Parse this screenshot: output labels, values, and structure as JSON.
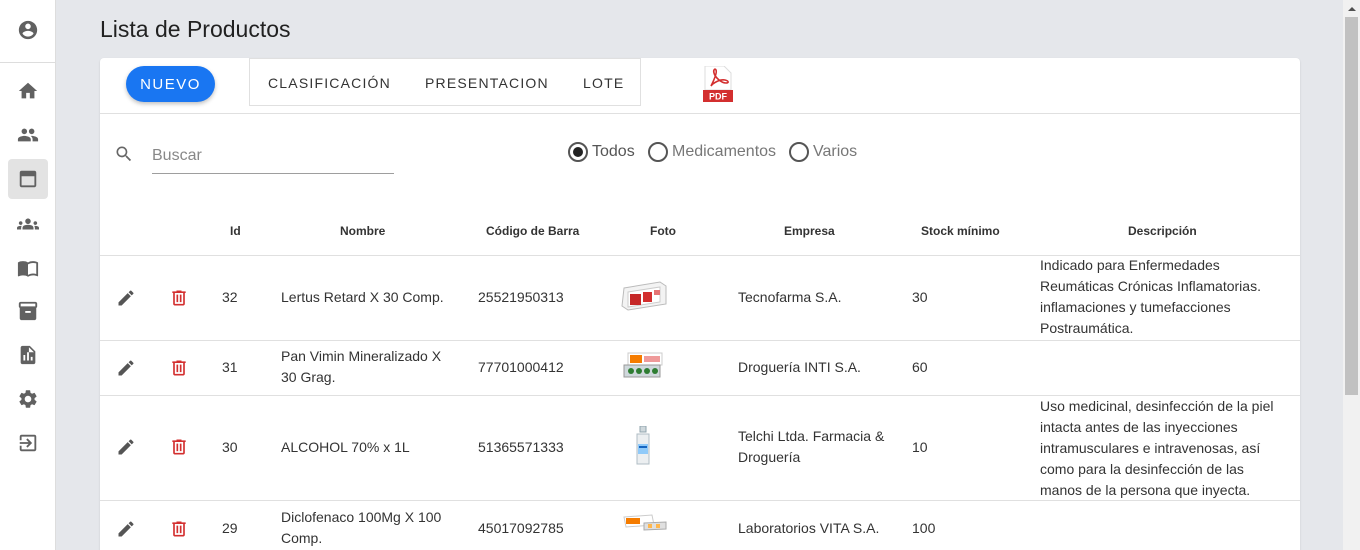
{
  "page": {
    "title": "Lista de Productos"
  },
  "sidebar": {
    "items": [
      {
        "icon": "account-circle-icon"
      },
      {
        "icon": "home-icon"
      },
      {
        "icon": "users-icon"
      },
      {
        "icon": "product-box-icon",
        "active": true
      },
      {
        "icon": "groups-icon"
      },
      {
        "icon": "book-icon"
      },
      {
        "icon": "archive-icon"
      },
      {
        "icon": "report-icon"
      },
      {
        "icon": "gear-icon"
      },
      {
        "icon": "logout-icon"
      }
    ]
  },
  "toolbar": {
    "new_label": "NUEVO",
    "tabs": [
      "CLASIFICACIÓN",
      "PRESENTACION",
      "LOTE"
    ],
    "pdf_label": "PDF"
  },
  "search": {
    "placeholder": "Buscar"
  },
  "filters": {
    "options": [
      "Todos",
      "Medicamentos",
      "Varios"
    ],
    "selected": "Todos"
  },
  "table": {
    "columns": [
      "Id",
      "Nombre",
      "Código de Barra",
      "Foto",
      "Empresa",
      "Stock mínimo",
      "Descripción"
    ],
    "rows": [
      {
        "id": "32",
        "nombre": "Lertus Retard X 30 Comp.",
        "codigo": "25521950313",
        "empresa": "Tecnofarma S.A.",
        "stock": "30",
        "descripcion": "Indicado para Enfermedades Reumáticas Crónicas Inflamatorias. inflamaciones y tumefacciones Postraumática."
      },
      {
        "id": "31",
        "nombre": "Pan Vimin Mineralizado X 30 Grag.",
        "codigo": "77701000412",
        "empresa": "Droguería INTI S.A.",
        "stock": "60",
        "descripcion": ""
      },
      {
        "id": "30",
        "nombre": "ALCOHOL 70% x 1L",
        "codigo": "51365571333",
        "empresa": "Telchi Ltda. Farmacia & Droguería",
        "stock": "10",
        "descripcion": "Uso medicinal, desinfección de la piel intacta antes de las inyecciones intramusculares e intravenosas, así como para la desinfección de las manos de la persona que inyecta."
      },
      {
        "id": "29",
        "nombre": "Diclofenaco 100Mg X 100 Comp.",
        "codigo": "45017092785",
        "empresa": "Laboratorios VITA S.A.",
        "stock": "100",
        "descripcion": ""
      }
    ]
  },
  "colors": {
    "primary": "#1976f2",
    "delete": "#d32f2f",
    "background": "#e5e7eb"
  }
}
